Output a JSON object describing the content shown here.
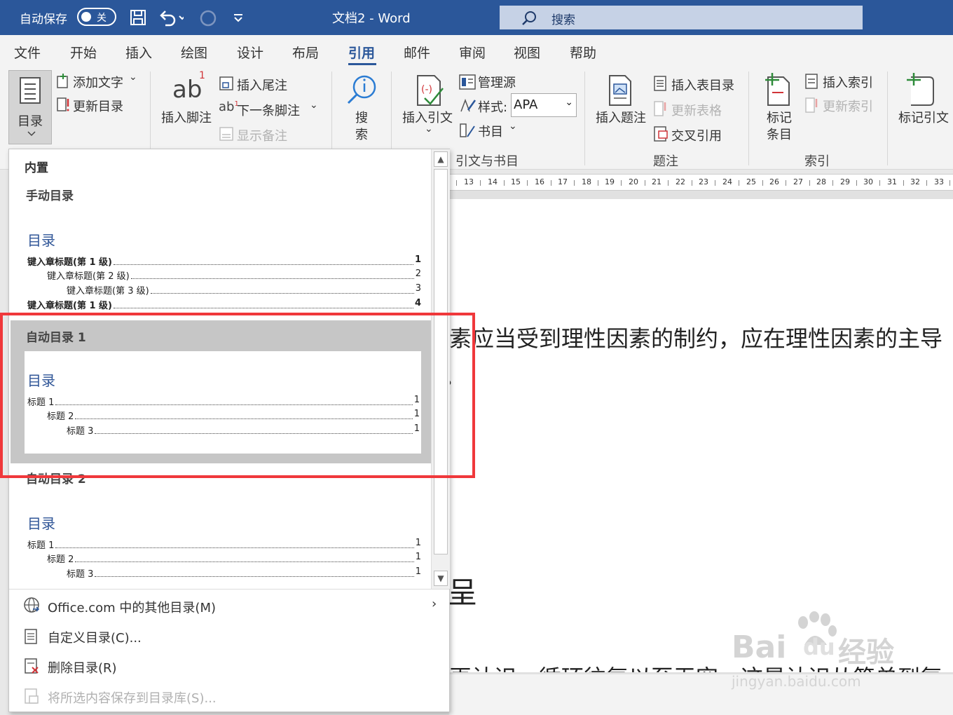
{
  "titlebar": {
    "autosave_label": "自动保存",
    "autosave_state": "关",
    "doc_title": "文档2  -  Word",
    "search_placeholder": "搜索"
  },
  "menu_tabs": [
    "文件",
    "开始",
    "插入",
    "绘图",
    "设计",
    "布局",
    "引用",
    "邮件",
    "审阅",
    "视图",
    "帮助"
  ],
  "active_tab": "引用",
  "ribbon": {
    "toc": {
      "button": "目录",
      "add_text": "添加文字",
      "update_toc": "更新目录"
    },
    "footnotes": {
      "insert_footnote": "插入脚注",
      "insert_endnote": "插入尾注",
      "next_footnote": "下一条脚注",
      "show_notes": "显示备注"
    },
    "search": {
      "label_line1": "搜",
      "label_line2": "索"
    },
    "citations": {
      "insert_citation": "插入引文",
      "manage_sources": "管理源",
      "style_label": "样式:",
      "style_value": "APA",
      "bibliography": "书目",
      "group_label": "引文与书目"
    },
    "captions": {
      "insert_caption": "插入题注",
      "insert_table_of_figures": "插入表目录",
      "update_table": "更新表格",
      "cross_reference": "交叉引用",
      "group_label": "题注"
    },
    "index": {
      "mark_entry_line1": "标记",
      "mark_entry_line2": "条目",
      "insert_index": "插入索引",
      "update_index": "更新索引",
      "group_label": "索引"
    },
    "table_of_authorities": {
      "mark_citation": "标记引文"
    }
  },
  "ruler_numbers": [
    "13",
    "14",
    "15",
    "16",
    "17",
    "18",
    "19",
    "20",
    "21",
    "22",
    "23",
    "24",
    "25",
    "26",
    "27",
    "28",
    "29",
    "30",
    "31",
    "32",
    "33"
  ],
  "document": {
    "line1": "素应当受到理性因素的制约，应在理性因素的主导",
    "line2": "。",
    "line3": "呈",
    "line4": "再认识，循环往复以至无穷，这是认识从简单到复"
  },
  "watermark": {
    "brand": "Bai",
    "brand2": "du",
    "cn": "经验",
    "url": "jingyan.baidu.com"
  },
  "toc_gallery": {
    "section_heading": "内置",
    "manual": {
      "label": "手动目录",
      "title": "目录",
      "entries": [
        {
          "text": "键入章标题(第 1 级)",
          "page": "1"
        },
        {
          "text": "键入章标题(第 2 级)",
          "page": "2"
        },
        {
          "text": "键入章标题(第 3 级)",
          "page": "3"
        },
        {
          "text": "键入章标题(第 1 级)",
          "page": "4"
        }
      ]
    },
    "auto1": {
      "label": "自动目录 1",
      "title": "目录",
      "entries": [
        {
          "text": "标题 1",
          "page": "1"
        },
        {
          "text": "标题 2",
          "page": "1"
        },
        {
          "text": "标题 3",
          "page": "1"
        }
      ]
    },
    "auto2": {
      "label": "自动目录 2",
      "title": "目录",
      "entries": [
        {
          "text": "标题 1",
          "page": "1"
        },
        {
          "text": "标题 2",
          "page": "1"
        },
        {
          "text": "标题 3",
          "page": "1"
        }
      ]
    },
    "menu": {
      "more_toc": "Office.com 中的其他目录(M)",
      "custom_toc": "自定义目录(C)...",
      "remove_toc": "删除目录(R)",
      "save_selection": "将所选内容保存到目录库(S)..."
    }
  },
  "colors": {
    "brand_blue": "#2b579a",
    "highlight_red": "#f0383b",
    "toc_title_blue": "#2f5597"
  }
}
